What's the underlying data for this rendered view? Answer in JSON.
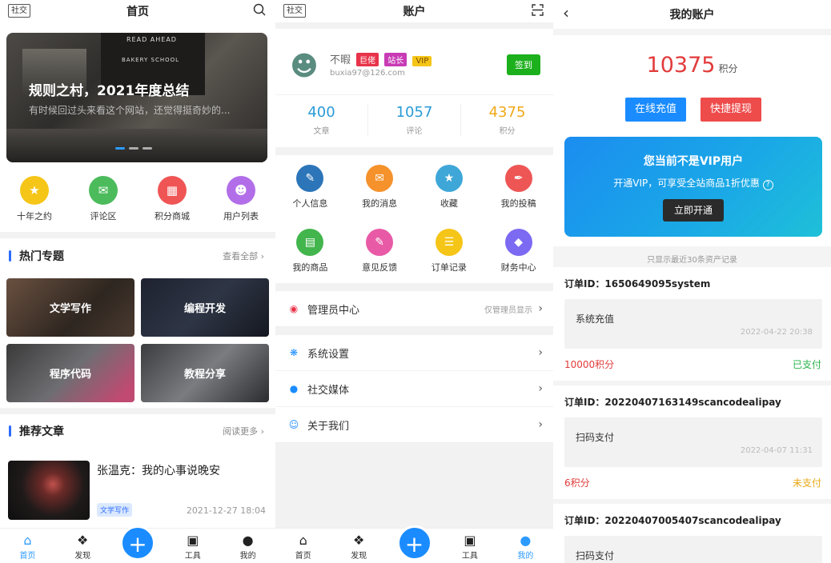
{
  "screen1": {
    "tag": "社交",
    "title": "首页",
    "banner": {
      "sign1": "READ AHEAD",
      "sign2": "BAKERY SCHOOL",
      "title": "规则之村，2021年度总结",
      "subtitle": "有时候回过头来看这个网站，还觉得挺奇妙的..."
    },
    "quick": [
      {
        "label": "十年之约",
        "icon": "trophy-icon",
        "color": "#f5c518"
      },
      {
        "label": "评论区",
        "icon": "chat-icon",
        "color": "#4cbb5c"
      },
      {
        "label": "积分商城",
        "icon": "shop-icon",
        "color": "#f05555"
      },
      {
        "label": "用户列表",
        "icon": "user-icon",
        "color": "#b26ee8"
      }
    ],
    "hot": {
      "title": "热门专题",
      "more": "查看全部"
    },
    "topics": [
      {
        "label": "文学写作"
      },
      {
        "label": "编程开发"
      },
      {
        "label": "程序代码"
      },
      {
        "label": "教程分享"
      }
    ],
    "rec": {
      "title": "推荐文章",
      "more": "阅读更多"
    },
    "article": {
      "title": "张温克：我的心事说晚安",
      "tag": "文学写作",
      "time": "2021-12-27 18:04"
    },
    "tabs": [
      {
        "label": "首页"
      },
      {
        "label": "发现"
      },
      {
        "label": "工具"
      },
      {
        "label": "我的"
      }
    ]
  },
  "screen2": {
    "tag": "社交",
    "title": "账户",
    "user": {
      "name": "不暇",
      "badges": [
        {
          "text": "巨佬",
          "color": "#e8334a"
        },
        {
          "text": "站长",
          "color": "#c83bb5"
        },
        {
          "text": "VIP",
          "color": "#f5c518"
        }
      ],
      "email": "buxia97@126.com",
      "sign": "签到"
    },
    "stats": [
      {
        "num": "400",
        "label": "文章",
        "color": "#2a9bd6"
      },
      {
        "num": "1057",
        "label": "评论",
        "color": "#2a9bd6"
      },
      {
        "num": "4375",
        "label": "积分",
        "color": "#f0a818"
      }
    ],
    "menu": [
      {
        "label": "个人信息",
        "icon": "edit-icon",
        "color": "#2c75b8"
      },
      {
        "label": "我的消息",
        "icon": "message-icon",
        "color": "#f5922b"
      },
      {
        "label": "收藏",
        "icon": "star-icon",
        "color": "#3fa7d8"
      },
      {
        "label": "我的投稿",
        "icon": "pen-icon",
        "color": "#ee5656"
      },
      {
        "label": "我的商品",
        "icon": "goods-icon",
        "color": "#43b54d"
      },
      {
        "label": "意见反馈",
        "icon": "feedback-icon",
        "color": "#e85aa6"
      },
      {
        "label": "订单记录",
        "icon": "order-icon",
        "color": "#f5c518"
      },
      {
        "label": "财务中心",
        "icon": "diamond-icon",
        "color": "#7c6af2"
      }
    ],
    "admin": {
      "label": "管理员中心",
      "note": "仅管理员显示"
    },
    "rows": [
      {
        "label": "系统设置",
        "icon": "settings-icon"
      },
      {
        "label": "社交媒体",
        "icon": "social-icon"
      },
      {
        "label": "关于我们",
        "icon": "about-icon"
      }
    ]
  },
  "screen3": {
    "title": "我的账户",
    "points": "10375",
    "unit": "积分",
    "recharge": "在线充值",
    "withdraw": "快捷提现",
    "vip": {
      "title": "您当前不是VIP用户",
      "sub": "开通VIP，可享受全站商品1折优惠",
      "button": "立即开通"
    },
    "note": "只显示最近30条资产记录",
    "orders": [
      {
        "id": "订单ID：1650649095system",
        "name": "系统充值",
        "time": "2022-04-22 20:38",
        "amount": "10000积分",
        "status": "已支付",
        "status_color": "#2ab34a"
      },
      {
        "id": "订单ID：20220407163149scancodealipay",
        "name": "扫码支付",
        "time": "2022-04-07 11:31",
        "amount": "6积分",
        "status": "未支付",
        "status_color": "#e8a818"
      },
      {
        "id": "订单ID：20220407005407scancodealipay",
        "name": "扫码支付"
      }
    ]
  }
}
